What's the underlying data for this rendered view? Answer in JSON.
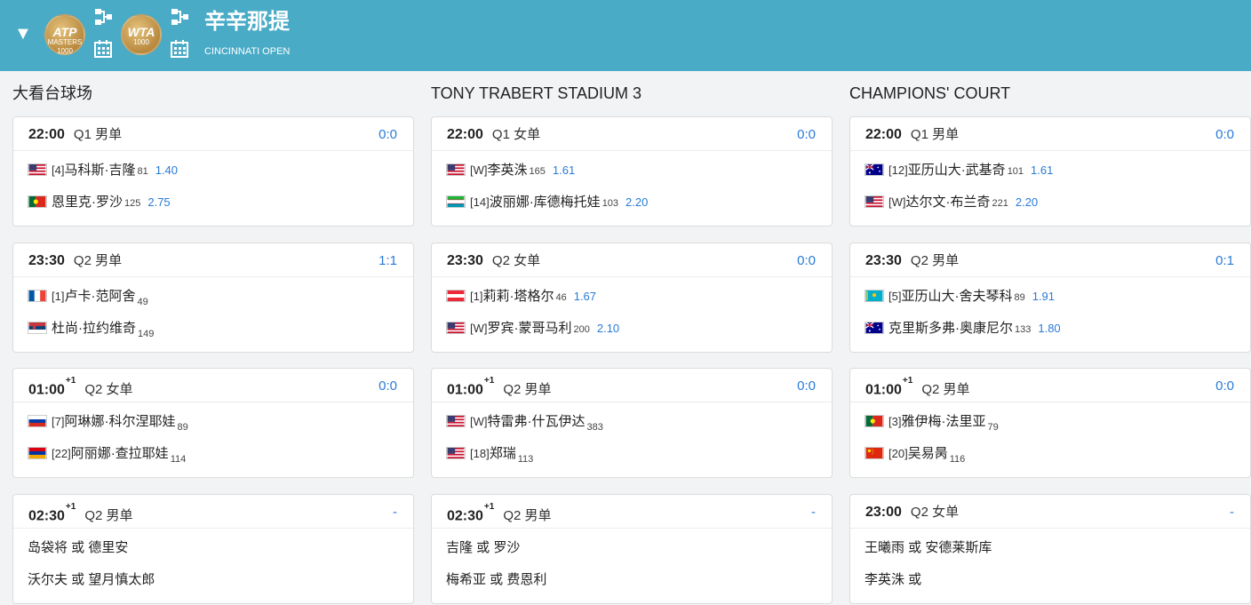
{
  "header": {
    "caret": "▼",
    "badges": [
      {
        "name": "atp-1000-badge",
        "text": "ATP",
        "sub": "MASTERS 1000"
      },
      {
        "name": "wta-1000-badge",
        "text": "WTA",
        "sub": "1000"
      }
    ],
    "title": "辛辛那提",
    "subtitle": "CINCINNATI OPEN"
  },
  "courts": [
    {
      "name": "大看台球场",
      "matches": [
        {
          "time": "22:00",
          "plus": "",
          "round": "Q1 男单",
          "score": "0:0",
          "p1": {
            "flag": "usa",
            "seed": "[4]",
            "name": "马科斯·吉隆",
            "rank": "81",
            "odds": "1.40"
          },
          "p2": {
            "flag": "por",
            "seed": "",
            "name": "恩里克·罗沙",
            "rank": "125",
            "odds": "2.75"
          }
        },
        {
          "time": "23:30",
          "plus": "",
          "round": "Q2 男单",
          "score": "1:1",
          "p1": {
            "flag": "fra",
            "seed": "[1]",
            "name": "卢卡·范阿舍",
            "rank": "49",
            "odds": ""
          },
          "p2": {
            "flag": "srb",
            "seed": "",
            "name": "杜尚·拉约维奇",
            "rank": "149",
            "odds": ""
          }
        },
        {
          "time": "01:00",
          "plus": "+1",
          "round": "Q2 女单",
          "score": "0:0",
          "p1": {
            "flag": "rus",
            "seed": "[7]",
            "name": "阿琳娜·科尔涅耶娃",
            "rank": "89",
            "odds": ""
          },
          "p2": {
            "flag": "arm",
            "seed": "[22]",
            "name": "阿丽娜·查拉耶娃",
            "rank": "114",
            "odds": ""
          }
        },
        {
          "time": "02:30",
          "plus": "+1",
          "round": "Q2 男单",
          "score": "-",
          "p1": {
            "flag": "",
            "seed": "",
            "name": "岛袋将 或 德里安",
            "rank": "",
            "odds": ""
          },
          "p2": {
            "flag": "",
            "seed": "",
            "name": "沃尔夫 或 望月慎太郎",
            "rank": "",
            "odds": ""
          }
        }
      ]
    },
    {
      "name": "TONY TRABERT STADIUM 3",
      "matches": [
        {
          "time": "22:00",
          "plus": "",
          "round": "Q1 女单",
          "score": "0:0",
          "p1": {
            "flag": "usa",
            "seed": "[W]",
            "name": "李英洙",
            "rank": "165",
            "odds": "1.61"
          },
          "p2": {
            "flag": "uzb",
            "seed": "[14]",
            "name": "波丽娜·库德梅托娃",
            "rank": "103",
            "odds": "2.20"
          }
        },
        {
          "time": "23:30",
          "plus": "",
          "round": "Q2 女单",
          "score": "0:0",
          "p1": {
            "flag": "aut",
            "seed": "[1]",
            "name": "莉莉·塔格尔",
            "rank": "46",
            "odds": "1.67"
          },
          "p2": {
            "flag": "usa",
            "seed": "[W]",
            "name": "罗宾·蒙哥马利",
            "rank": "200",
            "odds": "2.10"
          }
        },
        {
          "time": "01:00",
          "plus": "+1",
          "round": "Q2 男单",
          "score": "0:0",
          "p1": {
            "flag": "usa",
            "seed": "[W]",
            "name": "特雷弗·什瓦伊达",
            "rank": "383",
            "odds": ""
          },
          "p2": {
            "flag": "usa",
            "seed": "[18]",
            "name": "郑瑞",
            "rank": "113",
            "odds": ""
          }
        },
        {
          "time": "02:30",
          "plus": "+1",
          "round": "Q2 男单",
          "score": "-",
          "p1": {
            "flag": "",
            "seed": "",
            "name": "吉隆 或 罗沙",
            "rank": "",
            "odds": ""
          },
          "p2": {
            "flag": "",
            "seed": "",
            "name": "梅希亚 或 费恩利",
            "rank": "",
            "odds": ""
          }
        }
      ]
    },
    {
      "name": "CHAMPIONS' COURT",
      "matches": [
        {
          "time": "22:00",
          "plus": "",
          "round": "Q1 男单",
          "score": "0:0",
          "p1": {
            "flag": "aus",
            "seed": "[12]",
            "name": "亚历山大·武基奇",
            "rank": "101",
            "odds": "1.61"
          },
          "p2": {
            "flag": "usa",
            "seed": "[W]",
            "name": "达尔文·布兰奇",
            "rank": "221",
            "odds": "2.20"
          }
        },
        {
          "time": "23:30",
          "plus": "",
          "round": "Q2 男单",
          "score": "0:1",
          "p1": {
            "flag": "kaz",
            "seed": "[5]",
            "name": "亚历山大·舍夫琴科",
            "rank": "89",
            "odds": "1.91"
          },
          "p2": {
            "flag": "aus",
            "seed": "",
            "name": "克里斯多弗·奥康尼尔",
            "rank": "133",
            "odds": "1.80"
          }
        },
        {
          "time": "01:00",
          "plus": "+1",
          "round": "Q2 男单",
          "score": "0:0",
          "p1": {
            "flag": "por",
            "seed": "[3]",
            "name": "雅伊梅·法里亚",
            "rank": "79",
            "odds": ""
          },
          "p2": {
            "flag": "chn",
            "seed": "[20]",
            "name": "吴易昺",
            "rank": "116",
            "odds": ""
          }
        },
        {
          "time": "23:00",
          "plus": "",
          "round": "Q2 女单",
          "score": "-",
          "p1": {
            "flag": "",
            "seed": "",
            "name": "王曦雨 或 安德莱斯库",
            "rank": "",
            "odds": ""
          },
          "p2": {
            "flag": "",
            "seed": "",
            "name": "李英洙 或",
            "rank": "",
            "odds": ""
          }
        }
      ]
    }
  ]
}
